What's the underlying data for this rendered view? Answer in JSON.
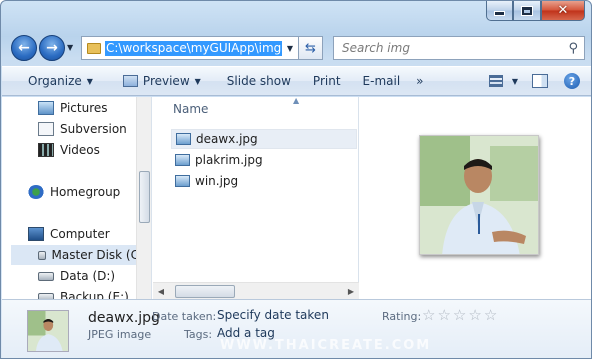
{
  "window": {
    "minimize_glyph": "minimize",
    "maximize_glyph": "maximize",
    "close_glyph": "✕"
  },
  "nav": {
    "back_glyph": "←",
    "forward_glyph": "→",
    "address_path": "C:\\workspace\\myGUIApp\\img",
    "search_placeholder": "Search img"
  },
  "toolbar": {
    "organize": "Organize",
    "preview": "Preview",
    "slideshow": "Slide show",
    "print": "Print",
    "email": "E-mail",
    "more": "»"
  },
  "sidebar": {
    "items": [
      {
        "label": "Pictures",
        "icon": "pictures-icon"
      },
      {
        "label": "Subversion",
        "icon": "subversion-icon"
      },
      {
        "label": "Videos",
        "icon": "videos-icon"
      },
      {
        "label": "Homegroup",
        "icon": "homegroup-icon"
      },
      {
        "label": "Computer",
        "icon": "computer-icon"
      },
      {
        "label": "Master Disk (C",
        "icon": "disk-icon"
      },
      {
        "label": "Data (D:)",
        "icon": "disk-icon"
      },
      {
        "label": "Backup (E:)",
        "icon": "disk-icon"
      }
    ]
  },
  "files": {
    "column_name": "Name",
    "items": [
      "deawx.jpg",
      "plakrim.jpg",
      "win.jpg"
    ]
  },
  "details": {
    "filename": "deawx.jpg",
    "filetype": "JPEG image",
    "date_label": "Date taken:",
    "date_value": "Specify date taken",
    "tags_label": "Tags:",
    "tags_value": "Add a tag",
    "rating_label": "Rating:",
    "rating_stars": 0,
    "watermark": "WWW.THAICREATE.COM"
  }
}
